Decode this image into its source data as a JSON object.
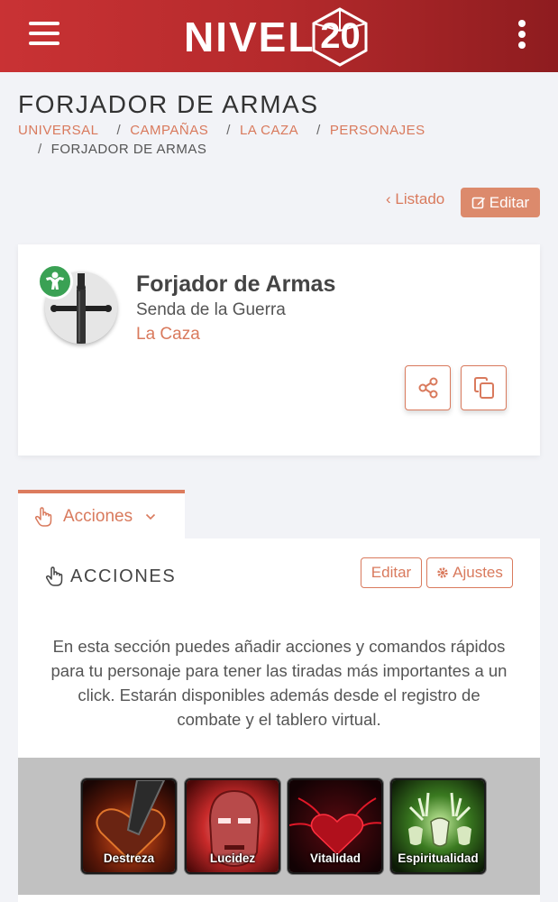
{
  "header": {
    "logo_text": "NIVEL",
    "logo_number": "20",
    "menu_icon": "hamburger-icon",
    "more_icon": "kebab-menu-icon",
    "brand_color": "#c93234"
  },
  "page": {
    "title": "FORJADOR DE ARMAS",
    "breadcrumbs": [
      "UNIVERSAL",
      "CAMPAÑAS",
      "LA CAZA",
      "PERSONAJES"
    ],
    "breadcrumb_current": "FORJADOR DE ARMAS",
    "separator": "/"
  },
  "actions": {
    "list_label": "Listado",
    "edit_label": "Editar",
    "accent_color": "#dc8a6c"
  },
  "character": {
    "name": "Forjador de Armas",
    "path": "Senda de la Guerra",
    "campaign": "La Caza",
    "badge_icon": "strongman-icon",
    "badge_color": "#3aa154",
    "share_icon": "share-icon",
    "copy_icon": "copy-icon"
  },
  "tab": {
    "label": "Acciones",
    "icon": "pointer-hand-icon"
  },
  "panel": {
    "title": "ACCIONES",
    "edit_label": "Editar",
    "settings_label": "Ajustes",
    "description": "En esta sección puedes añadir acciones y comandos rápidos para tu personaje para tener las tiradas más importantes a un click. Estarán disponibles además desde el registro de combate y el tablero virtual."
  },
  "attributes": [
    {
      "label": "Destreza",
      "icon": "heart-blade-icon"
    },
    {
      "label": "Lucidez",
      "icon": "glowing-face-icon"
    },
    {
      "label": "Vitalidad",
      "icon": "heart-veins-icon"
    },
    {
      "label": "Espiritualidad",
      "icon": "stag-skulls-icon"
    }
  ]
}
